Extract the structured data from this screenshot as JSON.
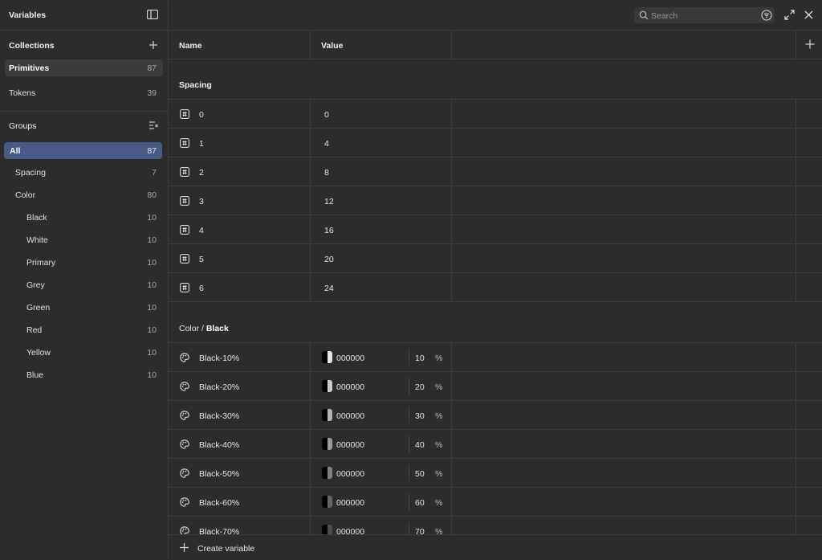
{
  "panel_title": "Variables",
  "collections": {
    "title": "Collections",
    "items": [
      {
        "label": "Primitives",
        "count": "87"
      },
      {
        "label": "Tokens",
        "count": "39"
      }
    ]
  },
  "groups": {
    "title": "Groups",
    "items": [
      {
        "label": "All",
        "count": "87"
      },
      {
        "label": "Spacing",
        "count": "7"
      },
      {
        "label": "Color",
        "count": "80"
      },
      {
        "label": "Black",
        "count": "10"
      },
      {
        "label": "White",
        "count": "10"
      },
      {
        "label": "Primary",
        "count": "10"
      },
      {
        "label": "Grey",
        "count": "10"
      },
      {
        "label": "Green",
        "count": "10"
      },
      {
        "label": "Red",
        "count": "10"
      },
      {
        "label": "Yellow",
        "count": "10"
      },
      {
        "label": "Blue",
        "count": "10"
      }
    ]
  },
  "search": {
    "placeholder": "Search"
  },
  "table": {
    "col_name": "Name",
    "col_value": "Value",
    "spacing_group": "Spacing",
    "spacing_rows": [
      {
        "name": "0",
        "value": "0"
      },
      {
        "name": "1",
        "value": "4"
      },
      {
        "name": "2",
        "value": "8"
      },
      {
        "name": "3",
        "value": "12"
      },
      {
        "name": "4",
        "value": "16"
      },
      {
        "name": "5",
        "value": "20"
      },
      {
        "name": "6",
        "value": "24"
      }
    ],
    "color_group_prefix": "Color / ",
    "color_group_name": "Black",
    "color_rows": [
      {
        "name": "Black-10%",
        "hex": "000000",
        "opacity": "10",
        "unit": "%"
      },
      {
        "name": "Black-20%",
        "hex": "000000",
        "opacity": "20",
        "unit": "%"
      },
      {
        "name": "Black-30%",
        "hex": "000000",
        "opacity": "30",
        "unit": "%"
      },
      {
        "name": "Black-40%",
        "hex": "000000",
        "opacity": "40",
        "unit": "%"
      },
      {
        "name": "Black-50%",
        "hex": "000000",
        "opacity": "50",
        "unit": "%"
      },
      {
        "name": "Black-60%",
        "hex": "000000",
        "opacity": "60",
        "unit": "%"
      },
      {
        "name": "Black-70%",
        "hex": "000000",
        "opacity": "70",
        "unit": "%"
      }
    ]
  },
  "footer": {
    "create_label": "Create variable"
  },
  "colors": {
    "accent": "#4a5a86",
    "background": "#2c2c2c",
    "border": "#3d3d3d"
  }
}
